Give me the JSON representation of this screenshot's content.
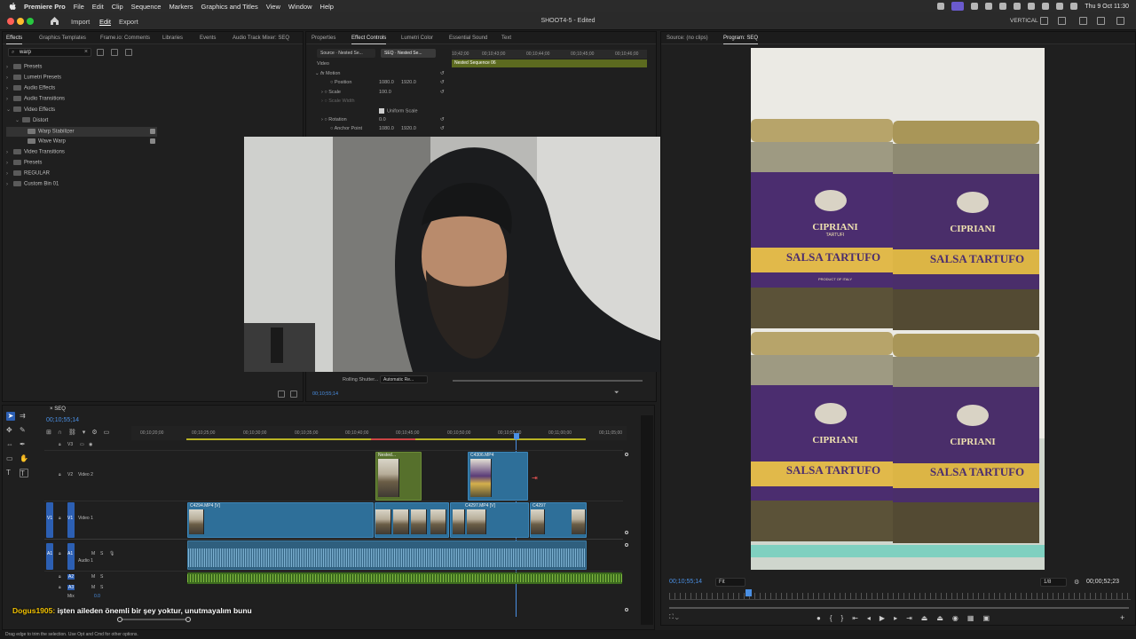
{
  "menubar": {
    "app": "Premiere Pro",
    "items": [
      "File",
      "Edit",
      "Clip",
      "Sequence",
      "Markers",
      "Graphics and Titles",
      "View",
      "Window",
      "Help"
    ],
    "clock": "Thu 9 Oct  11:30"
  },
  "titlebar": {
    "workspaces": [
      "Import",
      "Edit",
      "Export"
    ],
    "active_workspace": "Edit",
    "title": "SHOOT4-5 - Edited",
    "right_label": "VERTICAL"
  },
  "effects_panel": {
    "tabs": [
      "Effects",
      "Graphics Templates",
      "Frame.io: Comments",
      "Libraries",
      "Events",
      "Audio Track Mixer: SEQ"
    ],
    "search_value": "warp",
    "tree": [
      {
        "label": "Presets",
        "depth": 0
      },
      {
        "label": "Lumetri Presets",
        "depth": 0
      },
      {
        "label": "Audio Effects",
        "depth": 0
      },
      {
        "label": "Audio Transitions",
        "depth": 0
      },
      {
        "label": "Video Effects",
        "depth": 0,
        "open": true
      },
      {
        "label": "Distort",
        "depth": 1,
        "open": true
      },
      {
        "label": "Warp Stabilizer",
        "depth": 2,
        "selected": true
      },
      {
        "label": "Wave Warp",
        "depth": 2
      },
      {
        "label": "Video Transitions",
        "depth": 0
      },
      {
        "label": "Presets",
        "depth": 0
      },
      {
        "label": "REGULAR",
        "depth": 0
      },
      {
        "label": "Custom Bin 01",
        "depth": 0
      }
    ]
  },
  "effect_controls": {
    "tabs": [
      "Properties",
      "Effect Controls",
      "Lumetri Color",
      "Essential Sound",
      "Text"
    ],
    "source_tab": "Source · Nested Se...",
    "seq_tab": "SEQ · Nested Se...",
    "ruler_ticks": [
      "10;42;00",
      "00;10;43;00",
      "00;10;44;00",
      "00;10;45;00",
      "00;10;46;00"
    ],
    "clip_bar": "Nested Sequence 06",
    "section_video": "Video",
    "motion": "Motion",
    "position_label": "Position",
    "position_x": "1080.0",
    "position_y": "1920.0",
    "scale_label": "Scale",
    "scale_value": "100.0",
    "scale_width_label": "Scale Width",
    "uniform_label": "Uniform Scale",
    "rotation_label": "Rotation",
    "rotation_value": "0.0",
    "anchor_label": "Anchor Point",
    "anchor_x": "1080.0",
    "anchor_y": "1920.0",
    "rolling_label": "Rolling Shutter...",
    "rolling_value": "Automatic Re...",
    "timecode": "00;10;55;14"
  },
  "program_monitor": {
    "tabs": [
      "Source: (no clips)",
      "Program: SEQ"
    ],
    "timecode": "00;10;55;14",
    "fit": "Fit",
    "resolution": "1/8",
    "duration": "00;00;52;23",
    "jar_brand": "CIPRIANI",
    "jar_sub": "TARTUFI",
    "jar_product": "SALSA TARTUFO",
    "jar_origin": "PRODUCT OF ITALY"
  },
  "timeline": {
    "seq_tab": "SEQ",
    "timecode": "00;10;55;14",
    "ruler": [
      "00;10;20;00",
      "00;10;25;00",
      "00;10;30;00",
      "00;10;35;00",
      "00;10;40;00",
      "00;10;45;00",
      "00;10;50;00",
      "00;10;55;00",
      "00;11;00;00",
      "00;11;05;00"
    ],
    "tracks": {
      "v3": "V3",
      "v2": "V2",
      "v2_name": "Video 2",
      "v1": "V1",
      "v1_name": "Video 1",
      "a1": "A1",
      "a1_name": "Audio 1",
      "a2": "A2",
      "a3": "A3",
      "mix": "Mix",
      "mix_value": "0.0"
    },
    "clips": {
      "c1": "C4294.MP4 [V]",
      "c2": "C4297.MP4 [V]",
      "c3": "C4297",
      "nested": "Nested...",
      "c4": "C4306.MP4"
    }
  },
  "chat": {
    "user": "Dogus1905:",
    "message": "işten aileden önemli bir şey yoktur, unutmayalım bunu"
  },
  "status": "Drag edge to trim the selection. Use Opt and Cmd for other options.",
  "colors": {
    "accent": "#2c5fb3",
    "clip_video": "#2e6f99",
    "clip_nested": "#56702c",
    "audio_green": "#7fb83f"
  }
}
